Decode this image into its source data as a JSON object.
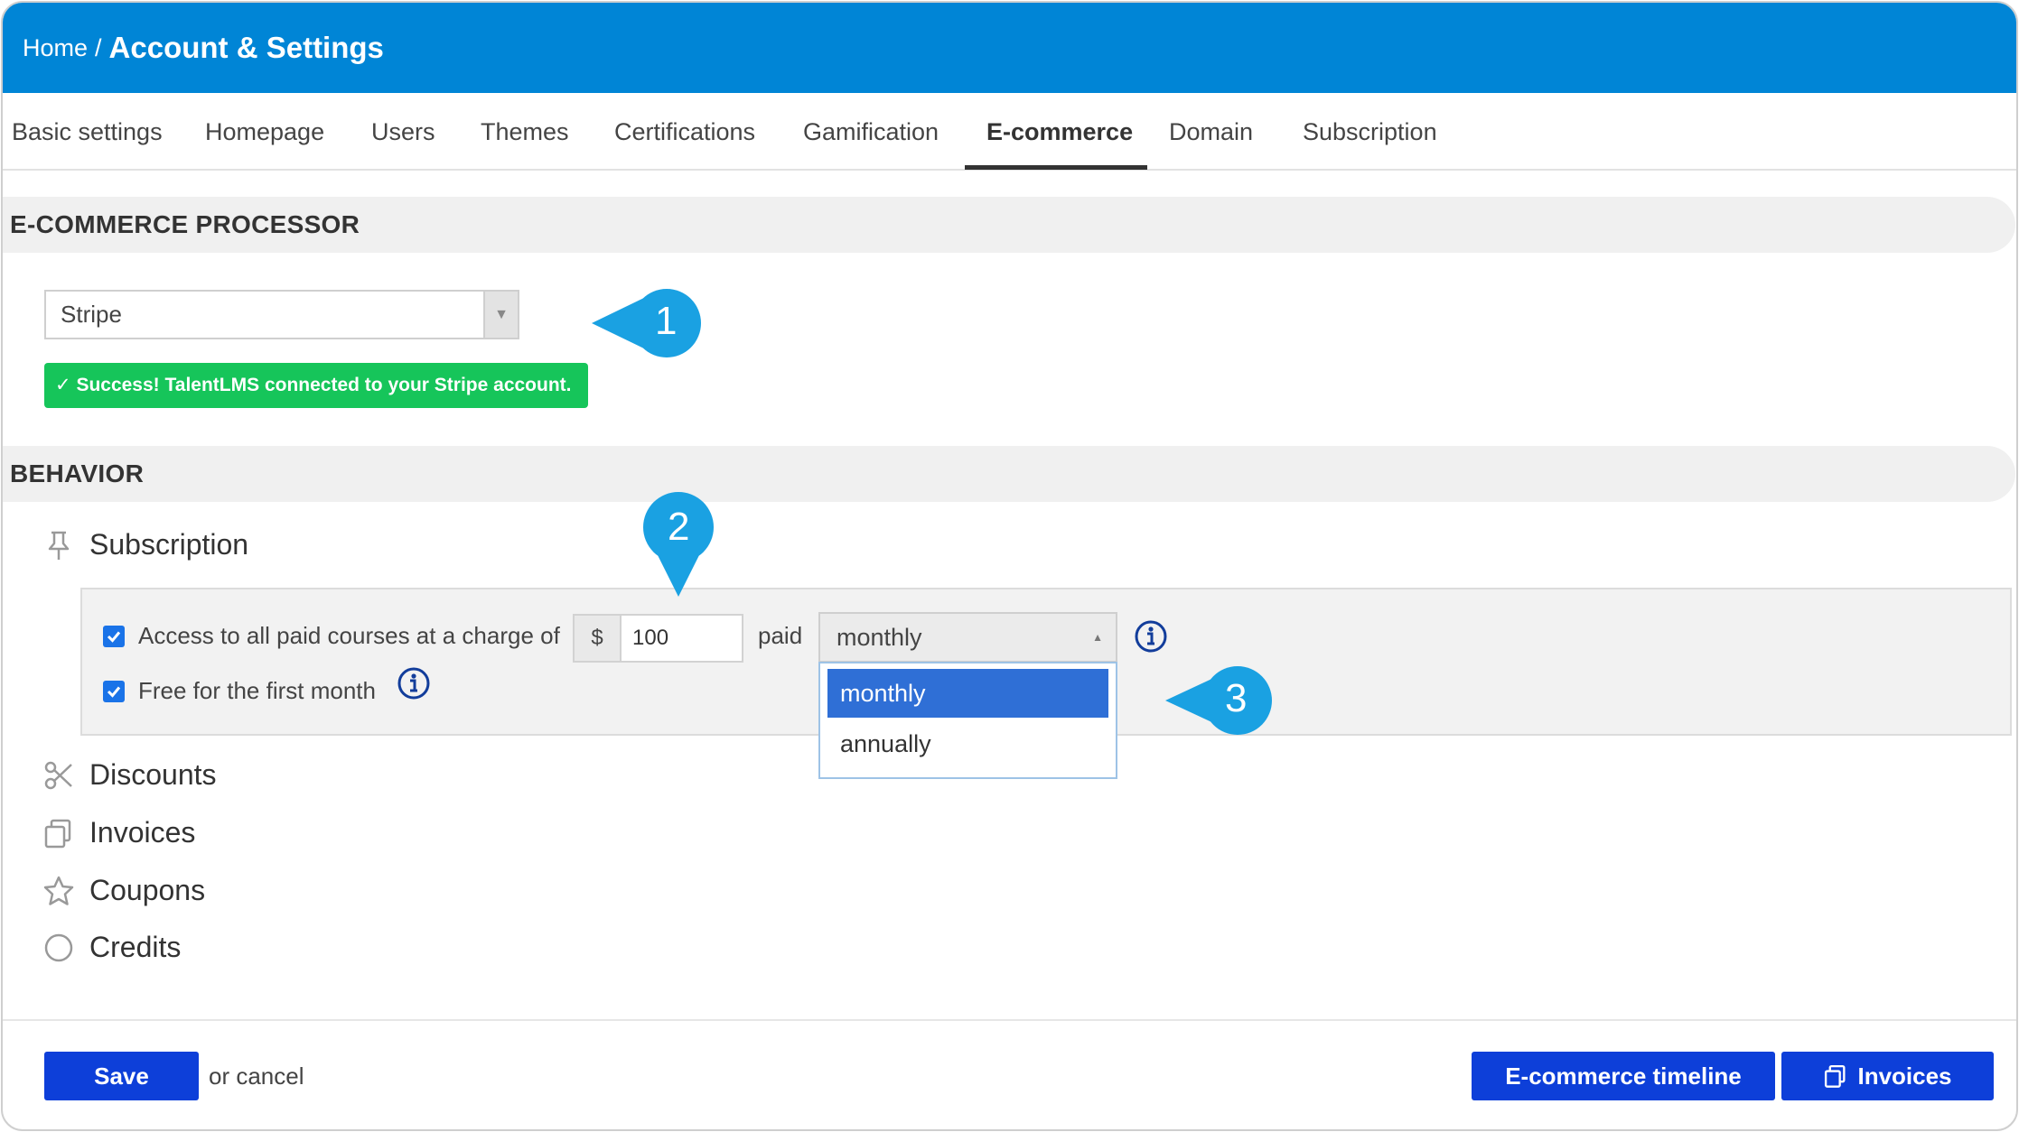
{
  "breadcrumb": {
    "home": "Home",
    "separator": "/",
    "title": "Account & Settings"
  },
  "tabs": [
    {
      "label": "Basic settings"
    },
    {
      "label": "Homepage"
    },
    {
      "label": "Users"
    },
    {
      "label": "Themes"
    },
    {
      "label": "Certifications"
    },
    {
      "label": "Gamification"
    },
    {
      "label": "E-commerce",
      "active": true
    },
    {
      "label": "Domain"
    },
    {
      "label": "Subscription"
    }
  ],
  "processor": {
    "heading": "E-COMMERCE PROCESSOR",
    "selected": "Stripe",
    "success_message": "Success! TalentLMS connected to your Stripe account."
  },
  "behavior": {
    "heading": "BEHAVIOR",
    "subscription_label": "Subscription",
    "access_text": "Access to all paid courses at a charge of",
    "access_checked": true,
    "currency_symbol": "$",
    "price": "100",
    "paid_text": "paid",
    "period_selected": "monthly",
    "period_options": [
      "monthly",
      "annually"
    ],
    "free_first_month_text": "Free for the first month",
    "free_first_month_checked": true,
    "discounts_label": "Discounts",
    "invoices_label": "Invoices",
    "coupons_label": "Coupons",
    "credits_label": "Credits"
  },
  "callouts": [
    "1",
    "2",
    "3"
  ],
  "footer": {
    "save_label": "Save",
    "or_cancel": "or cancel",
    "timeline_label": "E-commerce timeline",
    "invoices_label": "Invoices"
  },
  "colors": {
    "header": "#0085d6",
    "success": "#16c55a",
    "primary_button": "#0d3fd9",
    "callout": "#1aa1e2",
    "selected_option": "#2f6fd6"
  }
}
